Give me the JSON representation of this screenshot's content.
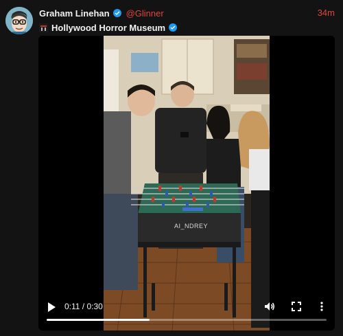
{
  "post": {
    "author_name": "Graham Linehan",
    "author_handle": "@Glinner",
    "timestamp": "34m",
    "repost_source": "Hollywood Horror Museum",
    "avatar_icon": "cartoon-face-avatar",
    "source_icon": "museum-logo-icon"
  },
  "video": {
    "watermark": "AI_NDREY",
    "current_time": "0:11",
    "separator": " / ",
    "duration": "0:30",
    "progress_fraction": 0.367,
    "controls": {
      "play_icon": "play-icon",
      "volume_icon": "volume-icon",
      "fullscreen_icon": "fullscreen-icon",
      "more_icon": "more-options-icon"
    }
  },
  "colors": {
    "accent": "#e0443f",
    "verified": "#1d9bf0",
    "background": "#131313"
  }
}
